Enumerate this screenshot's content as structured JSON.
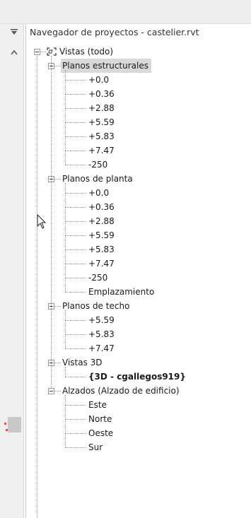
{
  "panel": {
    "title": "Navegador de proyectos - castelier.rvt",
    "menu_icon": "filter-icon",
    "collapse_icon": "chevron-up-icon"
  },
  "tree": {
    "root_label": "Vistas (todo)",
    "root_icon": "views-icon",
    "groups": [
      {
        "label": "Planos estructurales",
        "selected": true,
        "items": [
          "+0.0",
          "+0.36",
          "+2.88",
          "+5.59",
          "+5.83",
          "+7.47",
          "-250"
        ]
      },
      {
        "label": "Planos de planta",
        "items": [
          "+0.0",
          "+0.36",
          "+2.88",
          "+5.59",
          "+5.83",
          "+7.47",
          "-250",
          "Emplazamiento"
        ]
      },
      {
        "label": "Planos de techo",
        "items": [
          "+5.59",
          "+5.83",
          "+7.47"
        ]
      },
      {
        "label": "Vistas 3D",
        "items": [
          "{3D - cgallegos919}"
        ],
        "bold_item": true
      },
      {
        "label": "Alzados (Alzado de edificio)",
        "items": [
          "Este",
          "Norte",
          "Oeste",
          "Sur"
        ]
      }
    ]
  },
  "colors": {
    "selection": "#d9d9d9",
    "tree_line": "#9a9a9a",
    "accent_mark": "#e04040"
  }
}
